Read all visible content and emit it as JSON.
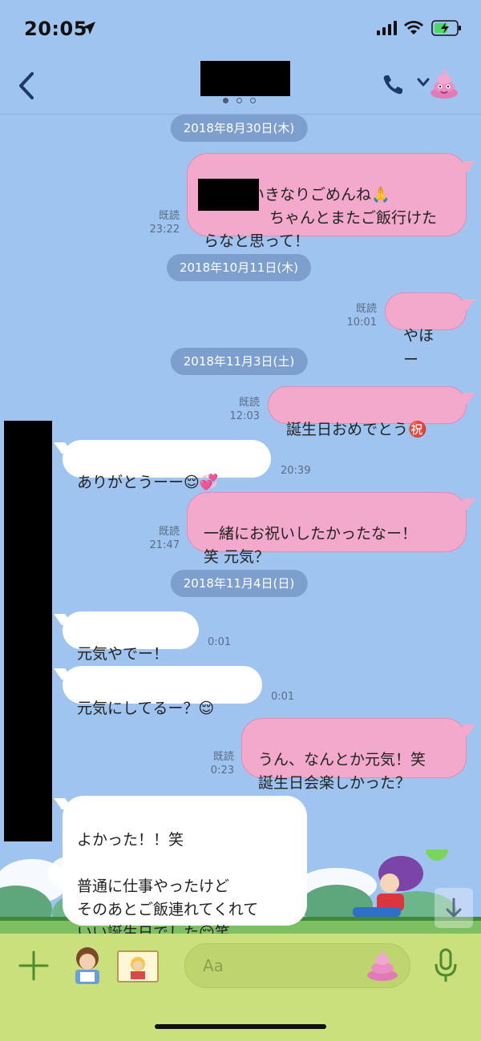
{
  "status_bar": {
    "time": "20:05"
  },
  "dates": [
    "2018年8月30日(木)",
    "2018年10月11日(木)",
    "2018年11月3日(土)",
    "2018年11月4日(日)"
  ],
  "messages": [
    {
      "dir": "out",
      "text": "昨日はいきなりごめんね🙏\n　　　　 ちゃんとまたご飯行けた\nらなと思って！",
      "read": "既読",
      "time": "23:22"
    },
    {
      "dir": "out",
      "text": "やほー",
      "read": "既読",
      "time": "10:01"
    },
    {
      "dir": "out",
      "text": "誕生日おめでとう㊗️",
      "read": "既読",
      "time": "12:03"
    },
    {
      "dir": "in",
      "text": "ありがとうーー😌💞",
      "time": "20:39"
    },
    {
      "dir": "out",
      "text": "一緒にお祝いしたかったなー！\n笑 元気？",
      "read": "既読",
      "time": "21:47"
    },
    {
      "dir": "in",
      "text": "元気やでー！",
      "time": "0:01"
    },
    {
      "dir": "in",
      "text": "元気にしてるー？😌",
      "time": "0:01"
    },
    {
      "dir": "out",
      "text": "うん、なんとか元気！笑\n誕生日会楽しかった？",
      "read": "既読",
      "time": "0:23"
    },
    {
      "dir": "in",
      "text": "よかった！！笑\n\n普通に仕事やったけど\nそのあとご飯連れてくれて\nいい誕生日でした😌笑"
    }
  ],
  "input": {
    "placeholder": "Aa"
  },
  "colors": {
    "background": "#9fc4f0",
    "out_bubble": "#f3a9cb",
    "in_bubble": "#ffffff",
    "input_bar": "#c9e07c"
  }
}
